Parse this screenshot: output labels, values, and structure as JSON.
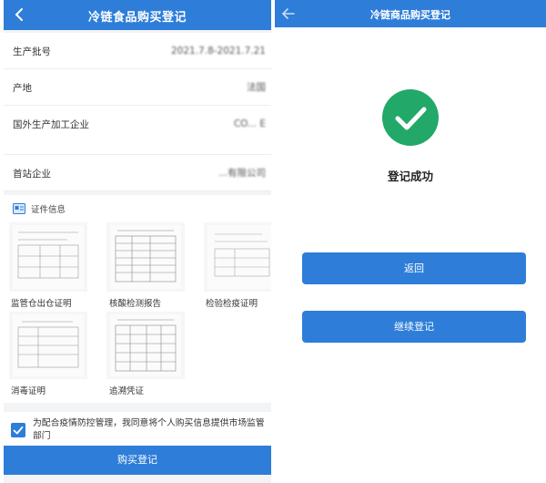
{
  "left_screen": {
    "title": "冷链食品购买登记",
    "info_rows": [
      {
        "label": "生产批号",
        "value": "2021.7.8-2021.7.21"
      },
      {
        "label": "产地",
        "value": "法国"
      },
      {
        "label": "国外生产加工企业",
        "value": "CO... E"
      },
      {
        "label": "首站企业",
        "value": "...有限公司"
      }
    ],
    "certificates": {
      "heading": "证件信息",
      "items": [
        {
          "label": "监管仓出仓证明"
        },
        {
          "label": "核酸检测报告"
        },
        {
          "label": "检验检疫证明"
        },
        {
          "label": "消毒证明"
        },
        {
          "label": "追溯凭证"
        }
      ]
    },
    "agreement_text": "为配合疫情防控管理，我同意将个人购买信息提供市场监管部门",
    "agreement_checked": true,
    "submit_label": "购买登记"
  },
  "right_screen": {
    "title": "冷链商品购买登记",
    "success_text": "登记成功",
    "buttons": {
      "back_label": "返回",
      "continue_label": "继续登记"
    }
  },
  "colors": {
    "primary": "#2e7dd9",
    "success": "#22a96a"
  },
  "icons": [
    "back-arrow-icon",
    "certificate-icon",
    "checkbox-checked-icon",
    "success-check-icon"
  ]
}
